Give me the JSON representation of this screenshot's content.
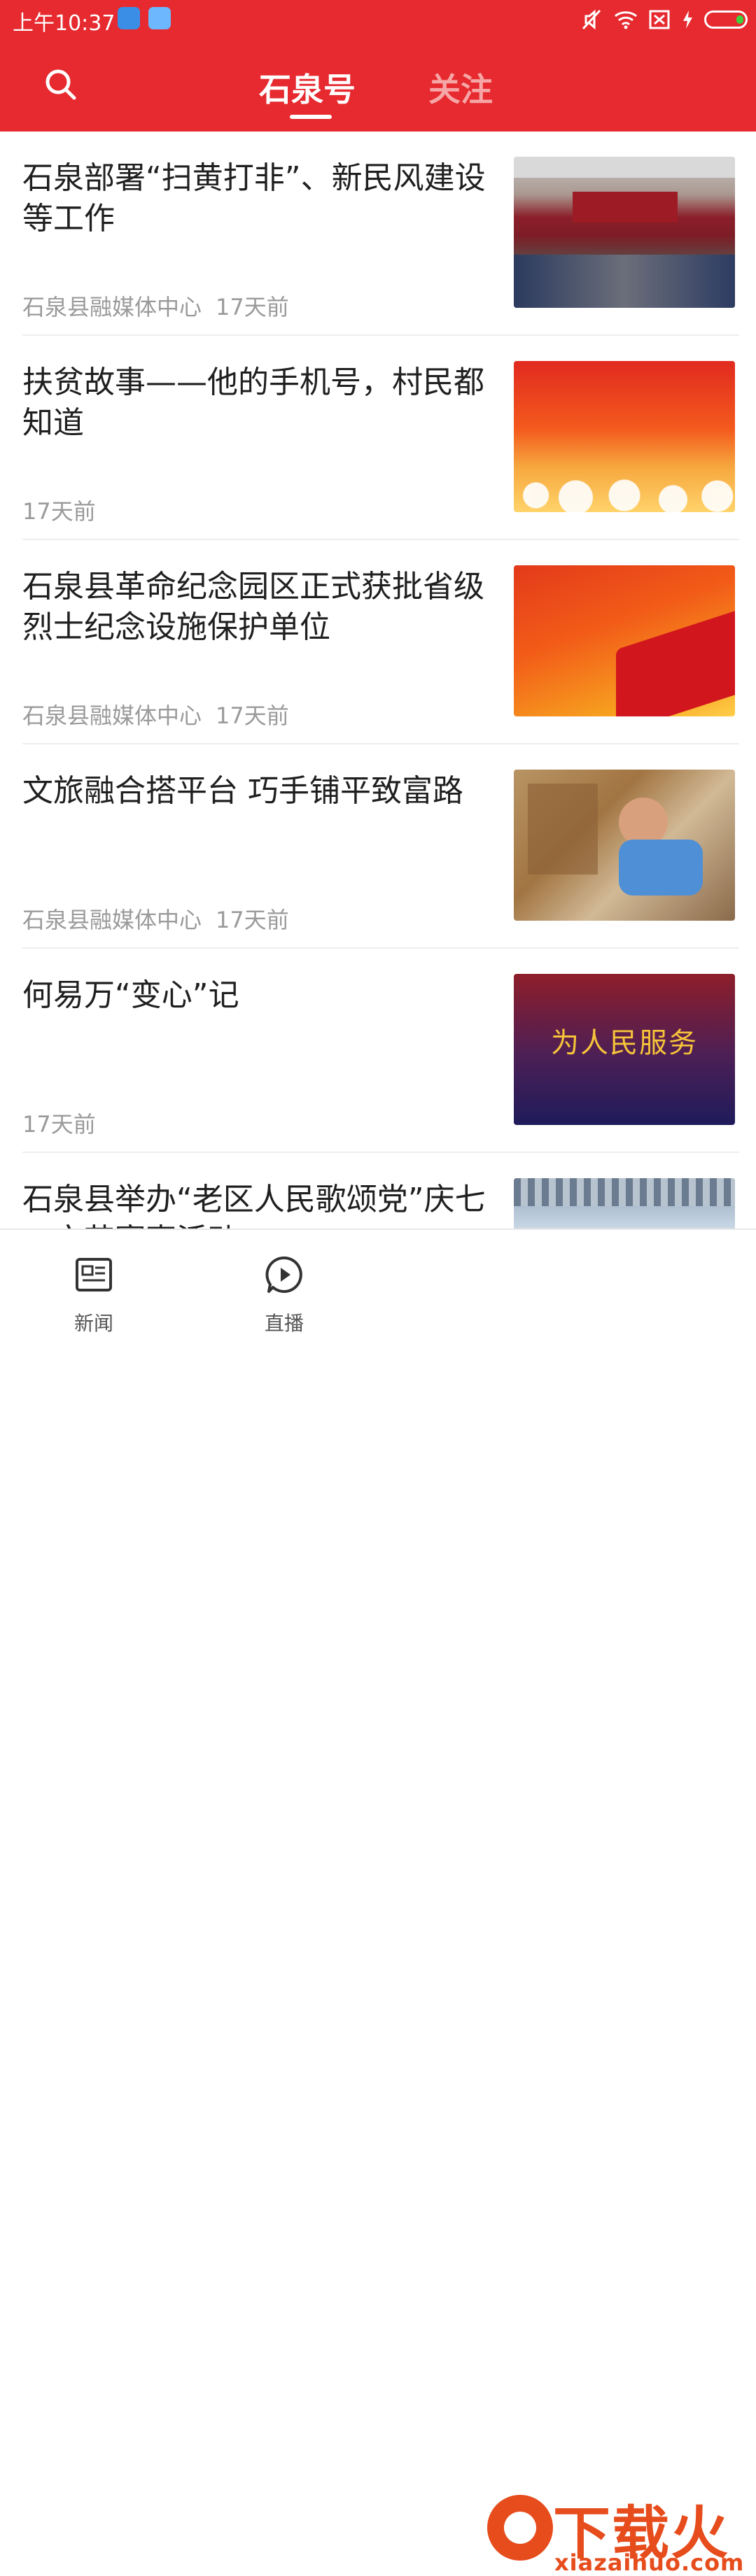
{
  "status_bar": {
    "time": "上午10:37",
    "icons": [
      "app-icon-blue",
      "app-icon-search",
      "mute-icon",
      "wifi-icon",
      "sim-icon",
      "charging-icon",
      "battery-icon"
    ]
  },
  "header": {
    "search_icon": "search-icon",
    "tabs": [
      {
        "label": "石泉号",
        "active": true
      },
      {
        "label": "关注",
        "active": false
      }
    ]
  },
  "feed": {
    "items": [
      {
        "title": "石泉部署“扫黄打非”、新民风建设等工作",
        "source": "石泉县融媒体中心",
        "time": "17天前",
        "thumb": "meeting-room"
      },
      {
        "title": "扶贫故事——他的手机号，村民都知道",
        "source": "",
        "time": "17天前",
        "thumb": "red-sky"
      },
      {
        "title": "石泉县革命纪念园区正式获批省级烈士纪念设施保护单位",
        "source": "石泉县融媒体中心",
        "time": "17天前",
        "thumb": "red-flag"
      },
      {
        "title": "文旅融合搭平台 巧手铺平致富路",
        "source": "石泉县融媒体中心",
        "time": "17天前",
        "thumb": "weaving-woman"
      },
      {
        "title": "何易万“变心”记",
        "source": "",
        "time": "17天前",
        "thumb": "serve-the-people",
        "thumb_text": "为人民服务"
      },
      {
        "title": "石泉县举办“老区人民歌颂党”庆七一文艺赛事活动",
        "source": "",
        "time": "",
        "thumb": "stage"
      }
    ]
  },
  "bottom_nav": {
    "items": [
      {
        "label": "新闻",
        "icon": "newspaper-icon"
      },
      {
        "label": "直播",
        "icon": "play-icon"
      }
    ]
  },
  "watermark": {
    "brand": "下载火",
    "url": "xiazaihuo.com"
  },
  "colors": {
    "primary_red": "#e62a2f",
    "inactive_tab": "#f6a6a6",
    "meta_gray": "#9a9a9a",
    "watermark_orange": "#e64c1c"
  }
}
